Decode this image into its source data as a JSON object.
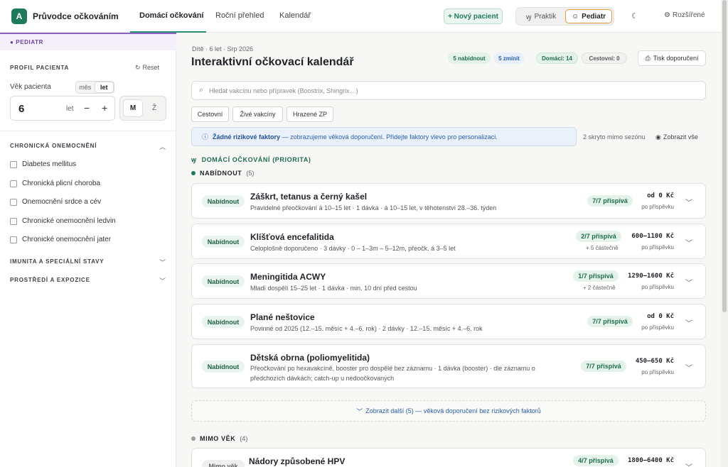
{
  "header": {
    "logo": "A",
    "app_title": "Průvodce očkováním",
    "tabs": [
      {
        "label": "Domácí očkování",
        "active": true
      },
      {
        "label": "Roční přehled",
        "active": false
      },
      {
        "label": "Kalendář",
        "active": false
      }
    ],
    "new_patient": "+ Nový pacient",
    "mode_praktik": "Praktik",
    "mode_pediatr": "Pediatr",
    "advanced": "Rozšířené"
  },
  "sidebar": {
    "mode_badge": "PEDIATR",
    "profile_label": "PROFIL PACIENTA",
    "reset": "Reset",
    "age_label": "Věk pacienta",
    "unit_month": "měs",
    "unit_year": "let",
    "age_value": "6",
    "age_unit": "let",
    "minus": "−",
    "plus": "+",
    "sex_m": "M",
    "sex_z": "Ž",
    "chronic_label": "CHRONICKÁ ONEMOCNĚNÍ",
    "conditions": [
      "Diabetes mellitus",
      "Chronická plicní choroba",
      "Onemocnění srdce a cév",
      "Chronické onemocnění ledvin",
      "Chronické onemocnění jater"
    ],
    "immunity_label": "IMUNITA A SPECIÁLNÍ STAVY",
    "environment_label": "PROSTŘEDÍ A EXPOZICE"
  },
  "main": {
    "breadcrumb": "Dítě · 6 let · Srp 2026",
    "title": "Interaktivní očkovací kalendář",
    "stats": {
      "offer": "5 nabídnout",
      "mention": "5 zmínit",
      "home": "Domácí: 14",
      "travel": "Cestovní: 0"
    },
    "print": "Tisk doporučení",
    "search_placeholder": "Hledat vakcínu nebo přípravek (Boostrix, Shingrix…)",
    "filters": [
      "Cestovní",
      "Živé vakcíny",
      "Hrazené ZP"
    ],
    "info_bold": "Žádné rizikové faktory",
    "info_text": "— zobrazujeme věková doporučení. Přidejte faktory vlevo pro personalizaci.",
    "hidden_count": "2 skryto mimo sezónu",
    "show_all": "Zobrazit vše",
    "section_title": "DOMÁCÍ OČKOVÁNÍ (PRIORITA)",
    "group_offer": "NABÍDNOUT",
    "group_offer_count": "(5)",
    "vaccines": [
      {
        "status": "Nabídnout",
        "name": "Záškrt, tetanus a černý kašel",
        "desc": "Pravidelné přeočkování á 10–15 let · 1 dávka · á 10–15 let, v těhotenství 28.–36. týden",
        "coverage": "7/7 přispívá",
        "partial": "",
        "price": "od 0 Kč",
        "price_sub": "po příspěvku"
      },
      {
        "status": "Nabídnout",
        "name": "Klíšťová encefalitida",
        "desc": "Celoplošně doporučeno · 3 dávky · 0 – 1–3m – 5–12m, přeočk. á 3–5 let",
        "coverage": "2/7 přispívá",
        "partial": "+ 5 částečně",
        "price": "600–1100 Kč",
        "price_sub": "po příspěvku"
      },
      {
        "status": "Nabídnout",
        "name": "Meningitida ACWY",
        "desc": "Mladí dospělí 15–25 let · 1 dávka · min. 10 dní před cestou",
        "coverage": "1/7 přispívá",
        "partial": "+ 2 částečně",
        "price": "1290–1600 Kč",
        "price_sub": "po příspěvku"
      },
      {
        "status": "Nabídnout",
        "name": "Plané neštovice",
        "desc": "Povinné od 2025 (12.–15. měsíc + 4.–6. rok) · 2 dávky · 12.–15. měsíc + 4.–6. rok",
        "coverage": "7/7 přispívá",
        "partial": "",
        "price": "od 0 Kč",
        "price_sub": "po příspěvku"
      },
      {
        "status": "Nabídnout",
        "name": "Dětská obrna (poliomyelitida)",
        "desc": "Přeočkování po hexavakcíně, booster pro dospělé bez záznamu · 1 dávka (booster) · dle záznamu o předchozích dávkách; catch-up u nedoočkovaných",
        "coverage": "7/7 přispívá",
        "partial": "",
        "price": "450–650 Kč",
        "price_sub": "po příspěvku"
      }
    ],
    "show_more": "Zobrazit další (5) — věková doporučení bez rizikových faktorů",
    "group_age": "MIMO VĚK",
    "group_age_count": "(4)",
    "age_vaccine": {
      "status": "Mimo věk",
      "name": "Nádory způsobené HPV",
      "coverage": "4/7 přispívá",
      "price": "1800–6400 Kč"
    }
  },
  "colors": {
    "brand": "#1f7a5c",
    "pediatr_accent": "#8e61c4",
    "active_mode_border": "#e39a3d",
    "info_blue": "#2b5fa8"
  }
}
